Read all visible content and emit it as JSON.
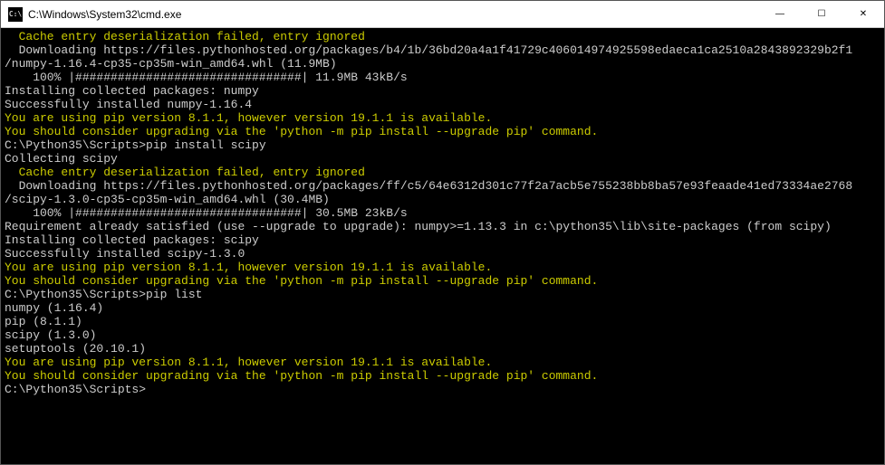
{
  "titlebar": {
    "icon_text": "C:\\",
    "title": "C:\\Windows\\System32\\cmd.exe",
    "minimize": "—",
    "maximize": "☐",
    "close": "✕"
  },
  "lines": [
    {
      "cls": "yel",
      "txt": "  Cache entry deserialization failed, entry ignored"
    },
    {
      "cls": "wht",
      "txt": "  Downloading https://files.pythonhosted.org/packages/b4/1b/36bd20a4a1f41729c406014974925598edaeca1ca2510a2843892329b2f1"
    },
    {
      "cls": "wht",
      "txt": "/numpy-1.16.4-cp35-cp35m-win_amd64.whl (11.9MB)"
    },
    {
      "cls": "wht",
      "txt": "    100% |################################| 11.9MB 43kB/s"
    },
    {
      "cls": "wht",
      "txt": "Installing collected packages: numpy"
    },
    {
      "cls": "wht",
      "txt": "Successfully installed numpy-1.16.4"
    },
    {
      "cls": "yel",
      "txt": "You are using pip version 8.1.1, however version 19.1.1 is available."
    },
    {
      "cls": "yel",
      "txt": "You should consider upgrading via the 'python -m pip install --upgrade pip' command."
    },
    {
      "cls": "wht",
      "txt": ""
    },
    {
      "cls": "prm",
      "txt": "C:\\Python35\\Scripts>pip install scipy"
    },
    {
      "cls": "wht",
      "txt": "Collecting scipy"
    },
    {
      "cls": "yel",
      "txt": "  Cache entry deserialization failed, entry ignored"
    },
    {
      "cls": "wht",
      "txt": "  Downloading https://files.pythonhosted.org/packages/ff/c5/64e6312d301c77f2a7acb5e755238bb8ba57e93feaade41ed73334ae2768"
    },
    {
      "cls": "wht",
      "txt": "/scipy-1.3.0-cp35-cp35m-win_amd64.whl (30.4MB)"
    },
    {
      "cls": "wht",
      "txt": "    100% |################################| 30.5MB 23kB/s"
    },
    {
      "cls": "wht",
      "txt": "Requirement already satisfied (use --upgrade to upgrade): numpy>=1.13.3 in c:\\python35\\lib\\site-packages (from scipy)"
    },
    {
      "cls": "wht",
      "txt": "Installing collected packages: scipy"
    },
    {
      "cls": "wht",
      "txt": "Successfully installed scipy-1.3.0"
    },
    {
      "cls": "yel",
      "txt": "You are using pip version 8.1.1, however version 19.1.1 is available."
    },
    {
      "cls": "yel",
      "txt": "You should consider upgrading via the 'python -m pip install --upgrade pip' command."
    },
    {
      "cls": "wht",
      "txt": ""
    },
    {
      "cls": "prm",
      "txt": "C:\\Python35\\Scripts>pip list"
    },
    {
      "cls": "wht",
      "txt": "numpy (1.16.4)"
    },
    {
      "cls": "wht",
      "txt": "pip (8.1.1)"
    },
    {
      "cls": "wht",
      "txt": "scipy (1.3.0)"
    },
    {
      "cls": "wht",
      "txt": "setuptools (20.10.1)"
    },
    {
      "cls": "yel",
      "txt": "You are using pip version 8.1.1, however version 19.1.1 is available."
    },
    {
      "cls": "yel",
      "txt": "You should consider upgrading via the 'python -m pip install --upgrade pip' command."
    },
    {
      "cls": "wht",
      "txt": ""
    },
    {
      "cls": "prm",
      "txt": "C:\\Python35\\Scripts>"
    }
  ]
}
